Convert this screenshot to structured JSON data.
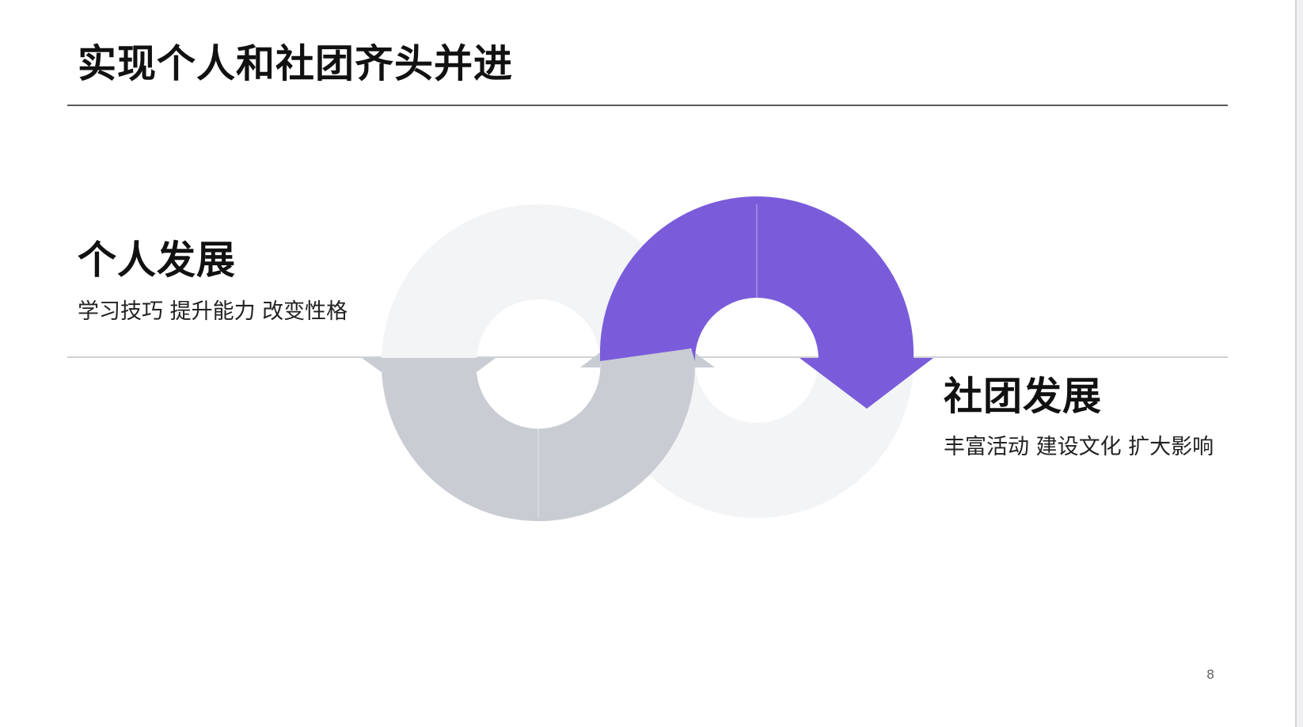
{
  "slide": {
    "title": "实现个人和社团齐头并进",
    "page_number": "8"
  },
  "left_block": {
    "heading": "个人发展",
    "subtext": "学习技巧 提升能力 改变性格"
  },
  "right_block": {
    "heading": "社团发展",
    "subtext": "丰富活动 建设文化 扩大影响"
  },
  "colors": {
    "accent": "#7a5cdb",
    "gray_arrow": "#c9cdd3",
    "light_ring": "#f3f4f6",
    "rule": "#5a5a5a",
    "mid_line": "#cfd2d6"
  },
  "icons": {
    "left_arrow": "gray-u-arrow-icon",
    "right_arrow": "purple-n-arrow-icon"
  }
}
